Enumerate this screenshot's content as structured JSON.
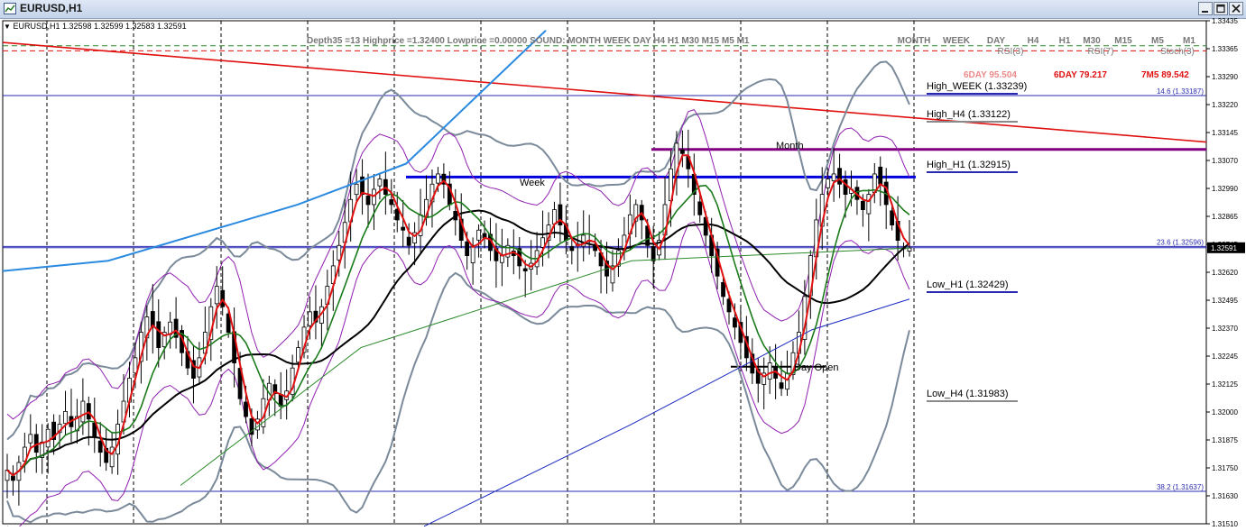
{
  "window": {
    "title": "EURUSD,H1"
  },
  "chart_data": {
    "type": "candlestick",
    "symbol_info": "EURUSD,H1 1.32598 1.32599 1.32583 1.32591",
    "indicator_text": "Depth35 =13 Highprice =1.32400 Lowprice =0.00000  SOUND:   MONTH  WEEK    DAY     H4     H1   M30   M15     M5     M1",
    "timeframes_right": [
      "MONTH",
      "WEEK",
      "DAY",
      "H4",
      "H1",
      "M30",
      "M15",
      "M5",
      "M1"
    ],
    "oscillator_headers": [
      {
        "text": "RSI(3)",
        "color": "#777777"
      },
      {
        "text": "RSI(7)",
        "color": "#777777"
      },
      {
        "text": "Stoch(3)",
        "color": "#777777"
      }
    ],
    "oscillator_values": [
      {
        "text": "6DAY  95.504",
        "color": "#ec8a8a"
      },
      {
        "text": "6DAY  79.217",
        "color": "#e01010"
      },
      {
        "text": "7M5  89.542",
        "color": "#e01010"
      }
    ],
    "y_axis": {
      "min": 1.3151,
      "max": 1.3348,
      "ticks": [
        "1.33435",
        "1.33365",
        "1.33290",
        "1.33220",
        "1.33145",
        "1.33070",
        "1.32990",
        "1.32865",
        "1.32745",
        "1.32620",
        "1.32495",
        "1.32370",
        "1.32245",
        "1.32125",
        "1.32000",
        "1.31875",
        "1.31750",
        "1.31630",
        "1.31510"
      ],
      "current_price": "1.32591"
    },
    "levels": [
      {
        "label": "High_WEEK (1.33239)",
        "value": 1.33239
      },
      {
        "label": "High_H4 (1.33122)",
        "value": 1.33122
      },
      {
        "label": "High_H1 (1.32915)",
        "value": 1.32915
      },
      {
        "label": "Low_H1 (1.32429)",
        "value": 1.32429
      },
      {
        "label": "Low_H4 (1.31983)",
        "value": 1.31983
      }
    ],
    "fibonacci": [
      {
        "label": "14.6 (1.33187)",
        "value": 1.33187
      },
      {
        "label": "23.6 (1.32596)",
        "value": 1.32596
      },
      {
        "label": "38.2 (1.31637)",
        "value": 1.31637
      }
    ],
    "annotations": {
      "month": "Month",
      "week": "Week",
      "day_open": "Day Open"
    },
    "ohlc_closes": [
      1.3172,
      1.3168,
      1.3175,
      1.3181,
      1.3186,
      1.3179,
      1.3183,
      1.3188,
      1.3184,
      1.319,
      1.3195,
      1.3189,
      1.3193,
      1.3199,
      1.3192,
      1.3185,
      1.3179,
      1.3175,
      1.3181,
      1.319,
      1.3199,
      1.3208,
      1.3216,
      1.3226,
      1.3232,
      1.3228,
      1.322,
      1.3226,
      1.323,
      1.3224,
      1.3218,
      1.3212,
      1.3208,
      1.3216,
      1.3226,
      1.3236,
      1.3244,
      1.3236,
      1.3226,
      1.3214,
      1.32,
      1.3193,
      1.3186,
      1.3192,
      1.32,
      1.3206,
      1.3202,
      1.3197,
      1.3203,
      1.3212,
      1.322,
      1.3228,
      1.3234,
      1.323,
      1.3236,
      1.3244,
      1.3252,
      1.326,
      1.3269,
      1.3278,
      1.3284,
      1.328,
      1.3276,
      1.3282,
      1.3286,
      1.328,
      1.3276,
      1.327,
      1.3266,
      1.326,
      1.3265,
      1.3272,
      1.3278,
      1.3284,
      1.3288,
      1.3284,
      1.3276,
      1.327,
      1.3262,
      1.3256,
      1.326,
      1.3266,
      1.3263,
      1.3258,
      1.3254,
      1.3256,
      1.326,
      1.3256,
      1.3252,
      1.325,
      1.3253,
      1.3258,
      1.3263,
      1.3268,
      1.3274,
      1.3268,
      1.3262,
      1.3258,
      1.326,
      1.3264,
      1.3262,
      1.3258,
      1.3252,
      1.3248,
      1.3252,
      1.3258,
      1.3264,
      1.3272,
      1.3276,
      1.327,
      1.326,
      1.3254,
      1.3262,
      1.3276,
      1.329,
      1.33,
      1.3296,
      1.329,
      1.328,
      1.3272,
      1.3264,
      1.3256,
      1.3248,
      1.324,
      1.3234,
      1.3228,
      1.3222,
      1.3216,
      1.321,
      1.3206,
      1.321,
      1.3214,
      1.3208,
      1.3204,
      1.321,
      1.3218,
      1.3226,
      1.324,
      1.3256,
      1.327,
      1.328,
      1.3286,
      1.3288,
      1.3284,
      1.328,
      1.3282,
      1.3278,
      1.3274,
      1.328,
      1.3288,
      1.3284,
      1.3276,
      1.3268,
      1.3262,
      1.3259,
      1.3259
    ]
  }
}
